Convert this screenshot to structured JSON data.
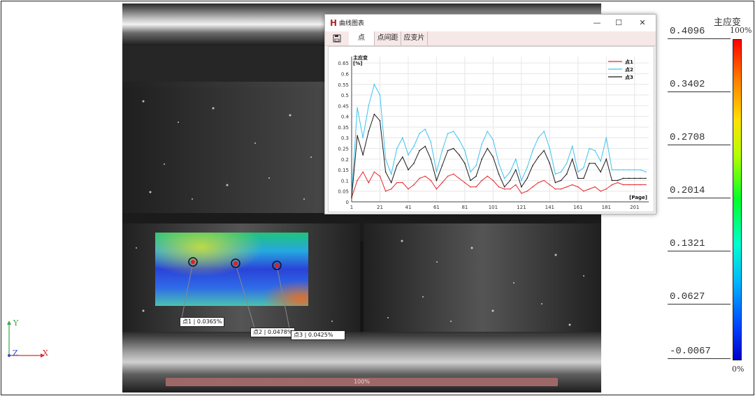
{
  "colors": {
    "series1": "#e8262b",
    "series2": "#3cc2f0",
    "series3": "#1a1a1a",
    "titlebar_bg": "#ffffff",
    "tabs_bg": "#f7e8e8",
    "progress_bar": "#b56060"
  },
  "axes_gizmo": {
    "y": "Y",
    "z": "Z",
    "x": "X"
  },
  "legend": {
    "title": "主应变",
    "top_pct": "100%",
    "bottom_pct": "0%",
    "ticks": [
      "0.4096",
      "0.3402",
      "0.2708",
      "0.2014",
      "0.1321",
      "0.0627",
      "-0.0067"
    ]
  },
  "window": {
    "app_icon": "H",
    "title": "曲线图表",
    "buttons": {
      "minimize": "—",
      "maximize": "☐",
      "close": "✕"
    },
    "toolbar_icon": "save-icon",
    "tabs": [
      "点",
      "点间距",
      "应变片"
    ],
    "active_tab": 0
  },
  "callouts": [
    {
      "label": "点1 | 0.0365%"
    },
    {
      "label": "点2 | 0.0478%"
    },
    {
      "label": "点3 | 0.0425%"
    }
  ],
  "progress": {
    "label": "100%",
    "value": 1.0
  },
  "chart_data": {
    "type": "line",
    "ylabel": "主应变\n[%]",
    "xlabel": "[Page]",
    "xlim": [
      1,
      211
    ],
    "ylim": [
      0,
      0.68
    ],
    "xticks": [
      1,
      21,
      41,
      61,
      81,
      101,
      121,
      141,
      161,
      181,
      201
    ],
    "yticks": [
      0,
      0.05,
      0.1,
      0.15,
      0.2,
      0.25,
      0.3,
      0.35,
      0.4,
      0.45,
      0.5,
      0.55,
      0.6,
      0.65
    ],
    "grid": true,
    "legend_position": "top-right",
    "series": [
      {
        "name": "点1",
        "color": "#e8262b",
        "x": [
          1,
          5,
          9,
          13,
          17,
          21,
          25,
          29,
          33,
          37,
          41,
          45,
          49,
          53,
          57,
          61,
          65,
          69,
          73,
          77,
          81,
          85,
          89,
          93,
          97,
          101,
          105,
          109,
          113,
          117,
          121,
          125,
          129,
          133,
          137,
          141,
          145,
          149,
          153,
          157,
          161,
          165,
          169,
          173,
          177,
          181,
          185,
          189,
          193,
          197,
          201,
          205,
          209
        ],
        "y": [
          0.02,
          0.1,
          0.14,
          0.09,
          0.14,
          0.12,
          0.05,
          0.06,
          0.09,
          0.09,
          0.06,
          0.08,
          0.11,
          0.12,
          0.1,
          0.06,
          0.09,
          0.12,
          0.13,
          0.11,
          0.09,
          0.07,
          0.07,
          0.1,
          0.12,
          0.1,
          0.07,
          0.06,
          0.06,
          0.08,
          0.04,
          0.05,
          0.07,
          0.09,
          0.1,
          0.08,
          0.06,
          0.06,
          0.07,
          0.08,
          0.07,
          0.05,
          0.06,
          0.07,
          0.05,
          0.06,
          0.08,
          0.09,
          0.08,
          0.08,
          0.08,
          0.08,
          0.08
        ]
      },
      {
        "name": "点2",
        "color": "#3cc2f0",
        "x": [
          1,
          5,
          9,
          13,
          17,
          21,
          25,
          29,
          33,
          37,
          41,
          45,
          49,
          53,
          57,
          61,
          65,
          69,
          73,
          77,
          81,
          85,
          89,
          93,
          97,
          101,
          105,
          109,
          113,
          117,
          121,
          125,
          129,
          133,
          137,
          141,
          145,
          149,
          153,
          157,
          161,
          165,
          169,
          173,
          177,
          181,
          185,
          189,
          193,
          197,
          201,
          205,
          209
        ],
        "y": [
          0.03,
          0.44,
          0.3,
          0.45,
          0.55,
          0.5,
          0.2,
          0.13,
          0.25,
          0.3,
          0.22,
          0.26,
          0.32,
          0.34,
          0.28,
          0.14,
          0.24,
          0.32,
          0.33,
          0.29,
          0.24,
          0.14,
          0.17,
          0.27,
          0.33,
          0.29,
          0.18,
          0.11,
          0.14,
          0.2,
          0.1,
          0.16,
          0.24,
          0.3,
          0.33,
          0.25,
          0.13,
          0.14,
          0.18,
          0.26,
          0.14,
          0.16,
          0.25,
          0.24,
          0.19,
          0.3,
          0.15,
          0.15,
          0.15,
          0.15,
          0.15,
          0.15,
          0.14
        ]
      },
      {
        "name": "点3",
        "color": "#1a1a1a",
        "x": [
          1,
          5,
          9,
          13,
          17,
          21,
          25,
          29,
          33,
          37,
          41,
          45,
          49,
          53,
          57,
          61,
          65,
          69,
          73,
          77,
          81,
          85,
          89,
          93,
          97,
          101,
          105,
          109,
          113,
          117,
          121,
          125,
          129,
          133,
          137,
          141,
          145,
          149,
          153,
          157,
          161,
          165,
          169,
          173,
          177,
          181,
          185,
          189,
          193,
          197,
          201,
          205,
          209
        ],
        "y": [
          0.02,
          0.31,
          0.22,
          0.33,
          0.41,
          0.38,
          0.14,
          0.09,
          0.17,
          0.21,
          0.15,
          0.18,
          0.24,
          0.26,
          0.2,
          0.1,
          0.17,
          0.24,
          0.25,
          0.22,
          0.18,
          0.1,
          0.12,
          0.2,
          0.25,
          0.21,
          0.13,
          0.07,
          0.1,
          0.15,
          0.07,
          0.11,
          0.17,
          0.21,
          0.24,
          0.18,
          0.09,
          0.1,
          0.13,
          0.2,
          0.11,
          0.11,
          0.18,
          0.18,
          0.14,
          0.2,
          0.1,
          0.1,
          0.11,
          0.11,
          0.11,
          0.11,
          0.11
        ]
      }
    ]
  }
}
